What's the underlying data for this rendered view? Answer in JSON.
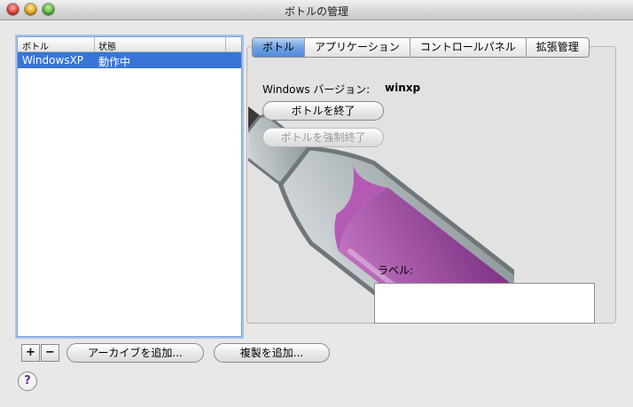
{
  "window": {
    "title": "ボトルの管理"
  },
  "bottle_list": {
    "columns": [
      "ボトル",
      "状態"
    ],
    "rows": [
      {
        "name": "WindowsXP",
        "status": "動作中"
      }
    ]
  },
  "list_buttons": {
    "add": "+",
    "remove": "−"
  },
  "footer_buttons": {
    "archive": "アーカイブを追加...",
    "duplicate": "複製を追加..."
  },
  "help": {
    "glyph": "?"
  },
  "tabs": [
    "ボトル",
    "アプリケーション",
    "コントロールパネル",
    "拡張管理"
  ],
  "bottle_panel": {
    "version_label": "Windows バージョン:",
    "version_value": "winxp",
    "stop_button": "ボトルを終了",
    "force_stop_button": "ボトルを強制終了",
    "label_field_label": "ラベル:",
    "label_field_value": ""
  },
  "colors": {
    "selection": "#3875d7",
    "wine": "#a64ca6",
    "help_mark": "#6a2d8f"
  },
  "icons": {
    "window_controls": [
      "close-icon",
      "minimize-icon",
      "zoom-icon"
    ],
    "illustration": "wine-bottle-icon"
  }
}
